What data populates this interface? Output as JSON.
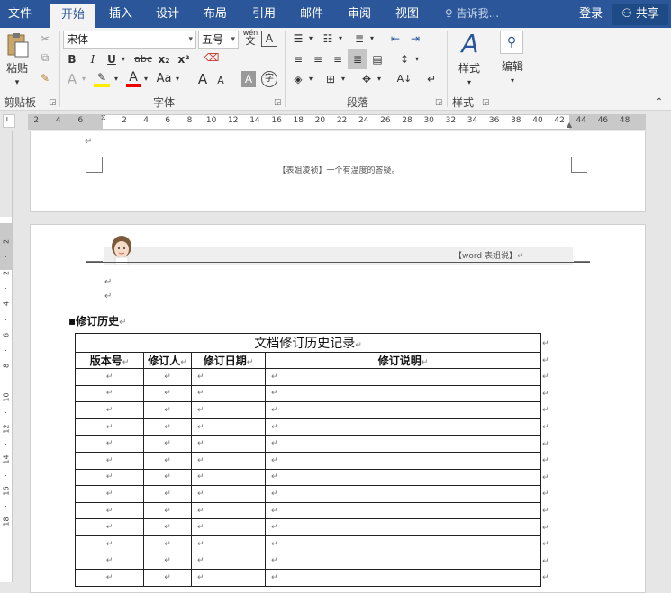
{
  "tabs": [
    "文件",
    "开始",
    "插入",
    "设计",
    "布局",
    "引用",
    "邮件",
    "审阅",
    "视图"
  ],
  "tell_me": "告诉我...",
  "login": "登录",
  "share": "共享",
  "clipboard": {
    "paste_label": "粘贴",
    "group_label": "剪贴板"
  },
  "font": {
    "name": "宋体",
    "size": "五号",
    "group_label": "字体",
    "phonetic_top": "wén",
    "phonetic_char": "文",
    "border_char": "A",
    "bold": "B",
    "italic": "I",
    "underline": "U",
    "strike": "abc",
    "subscript": "x₂",
    "superscript": "x²",
    "effects": "A",
    "color_a": "A",
    "case": "Aa",
    "grow": "A",
    "shrink": "A",
    "shade": "A",
    "enclose": "字"
  },
  "paragraph": {
    "group_label": "段落"
  },
  "styles": {
    "button_label": "样式",
    "group_label": "样式"
  },
  "editing": {
    "button_label": "编辑"
  },
  "ruler": {
    "left_ticks": [
      "6",
      "4",
      "2"
    ],
    "right_ticks": [
      "2",
      "4",
      "6",
      "8",
      "10",
      "12",
      "14",
      "16",
      "18",
      "20",
      "22",
      "24",
      "26",
      "28",
      "30",
      "32",
      "34",
      "36",
      "38",
      "40",
      "42",
      "44",
      "46",
      "48"
    ]
  },
  "vruler": {
    "ticks": [
      "2",
      "",
      "2",
      "",
      "4",
      "",
      "6",
      "",
      "8",
      "",
      "10",
      "",
      "12",
      "",
      "14",
      "",
      "16",
      "",
      "18"
    ]
  },
  "page1": {
    "header_text": "【表姐凌祯】一个有温度的答疑。"
  },
  "page2": {
    "header_right": "【word 表姐说】",
    "section_title": "修订历史",
    "table_title": "文档修订历史记录",
    "columns": [
      "版本号",
      "修订人",
      "修订日期",
      "修订说明"
    ],
    "row_count": 13
  },
  "para_mark": "↵"
}
